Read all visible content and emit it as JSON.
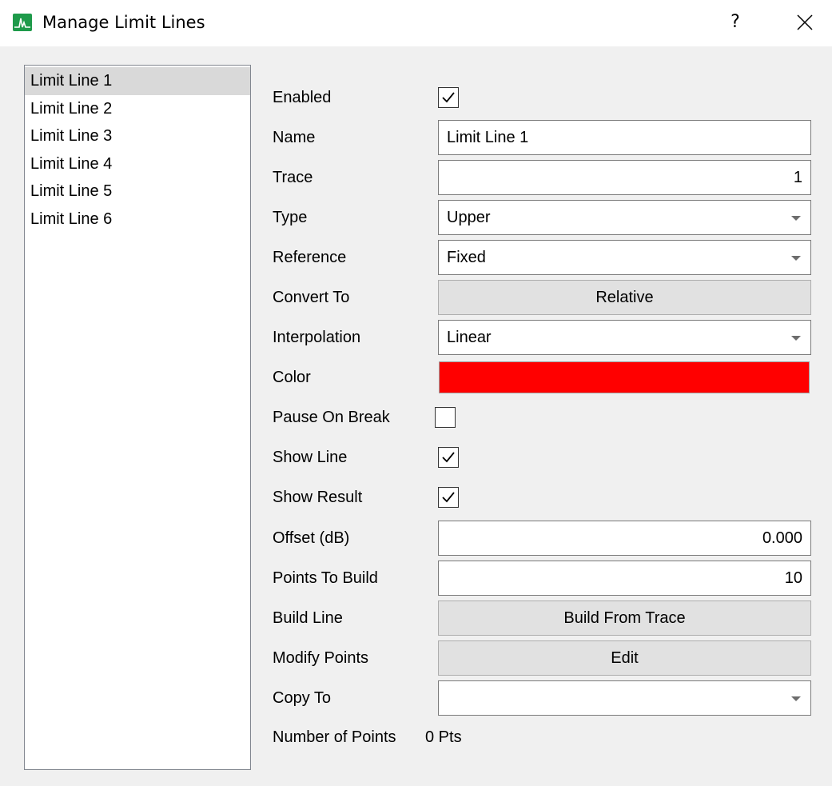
{
  "window": {
    "title": "Manage Limit Lines",
    "help_label": "?",
    "app_icon": "spectrum-icon",
    "close_icon": "close-icon"
  },
  "list": {
    "items": [
      "Limit Line 1",
      "Limit Line 2",
      "Limit Line 3",
      "Limit Line 4",
      "Limit Line 5",
      "Limit Line 6"
    ],
    "selected_index": 0
  },
  "form": {
    "enabled": {
      "label": "Enabled",
      "checked": true
    },
    "name": {
      "label": "Name",
      "value": "Limit Line 1"
    },
    "trace": {
      "label": "Trace",
      "value": "1"
    },
    "type": {
      "label": "Type",
      "value": "Upper"
    },
    "reference": {
      "label": "Reference",
      "value": "Fixed"
    },
    "convert_to": {
      "label": "Convert To",
      "button": "Relative"
    },
    "interpolation": {
      "label": "Interpolation",
      "value": "Linear"
    },
    "color": {
      "label": "Color",
      "value": "#ff0000"
    },
    "pause_on_break": {
      "label": "Pause On Break",
      "checked": false
    },
    "show_line": {
      "label": "Show Line",
      "checked": true
    },
    "show_result": {
      "label": "Show Result",
      "checked": true
    },
    "offset": {
      "label": "Offset (dB)",
      "value": "0.000"
    },
    "points_to_build": {
      "label": "Points To Build",
      "value": "10"
    },
    "build_line": {
      "label": "Build Line",
      "button": "Build From Trace"
    },
    "modify_points": {
      "label": "Modify Points",
      "button": "Edit"
    },
    "copy_to": {
      "label": "Copy To",
      "value": ""
    },
    "number_of_points": {
      "label": "Number of Points",
      "value": "0 Pts"
    }
  }
}
